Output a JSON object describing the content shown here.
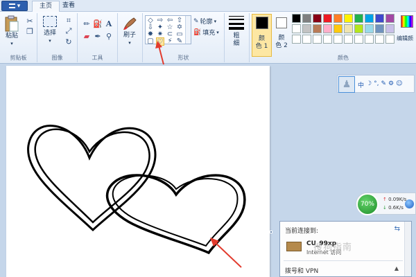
{
  "app_button": {
    "glyph": "▾"
  },
  "tabs": [
    {
      "label": "主页"
    },
    {
      "label": "查看"
    }
  ],
  "clipboard": {
    "paste_label": "粘贴",
    "group_label": "剪贴板"
  },
  "image": {
    "select_label": "选择",
    "group_label": "图像"
  },
  "tools": {
    "group_label": "工具",
    "text_tool": "A"
  },
  "brushes": {
    "label": "刷子"
  },
  "shapes": {
    "group_label": "形状",
    "outline_label": "轮廓",
    "fill_label": "填充",
    "gallery": [
      "◇",
      "⇨",
      "⇦",
      "⇧",
      "⇩",
      "✦",
      "☆",
      "✡",
      "✸",
      "✷",
      "⊂",
      "▭",
      "▢",
      "♡",
      "⚡",
      "✎"
    ],
    "selected_index": 13
  },
  "size": {
    "label1": "粗",
    "label2": "细"
  },
  "colors": {
    "color1_label1": "颜",
    "color1_label2": "色 1",
    "color2_label1": "颜",
    "color2_label2": "色 2",
    "group_label": "颜色",
    "edit_label1": "编辑颜",
    "color1": "#000000",
    "color2": "#ffffff",
    "palette": [
      "#000000",
      "#7f7f7f",
      "#880015",
      "#ed1c24",
      "#ff7f27",
      "#fff200",
      "#22b14c",
      "#00a2e8",
      "#3f48cc",
      "#a349a4",
      "#ffffff",
      "#c3c3c3",
      "#b97a57",
      "#ffaec9",
      "#ffc90e",
      "#efe4b0",
      "#b5e61d",
      "#99d9ea",
      "#7092be",
      "#c8bfe7",
      "#ffffff",
      "#ffffff",
      "#ffffff",
      "#ffffff",
      "#ffffff",
      "#ffffff",
      "#ffffff",
      "#ffffff",
      "#ffffff",
      "#ffffff"
    ]
  },
  "ime": {
    "items": [
      "中",
      "☽",
      "°,",
      "✎",
      "⚙",
      "☺"
    ]
  },
  "network": {
    "percent": "70%",
    "up": "0.09K/s",
    "down": "0.6K/s",
    "up_glyph": "↑",
    "down_glyph": "↓"
  },
  "popup": {
    "title": "当前连接到:",
    "connection_name": "CU_99xp",
    "connection_status": "Internet 访问",
    "section": "拨号和 VPN",
    "caret": "▲",
    "icon": "⇆"
  },
  "watermark": "搜狗指南"
}
